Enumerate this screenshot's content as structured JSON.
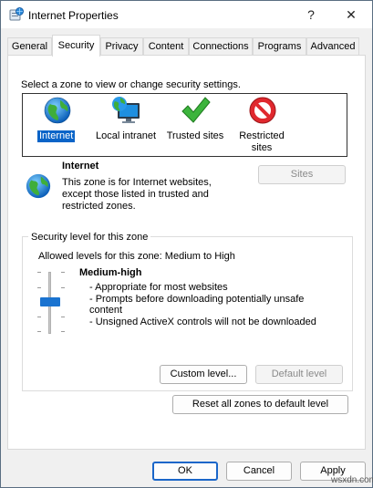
{
  "window": {
    "title": "Internet Properties",
    "help_glyph": "?",
    "close_glyph": "✕"
  },
  "tabs": [
    {
      "label": "General",
      "active": false
    },
    {
      "label": "Security",
      "active": true
    },
    {
      "label": "Privacy",
      "active": false
    },
    {
      "label": "Content",
      "active": false
    },
    {
      "label": "Connections",
      "active": false
    },
    {
      "label": "Programs",
      "active": false
    },
    {
      "label": "Advanced",
      "active": false
    }
  ],
  "security": {
    "prompt": "Select a zone to view or change security settings.",
    "zones": [
      {
        "label": "Internet",
        "icon": "globe-icon",
        "selected": true
      },
      {
        "label": "Local intranet",
        "icon": "monitor-globe-icon",
        "selected": false
      },
      {
        "label": "Trusted sites",
        "icon": "checkmark-icon",
        "selected": false
      },
      {
        "label": "Restricted\nsites",
        "icon": "no-entry-icon",
        "selected": false
      }
    ],
    "zone_info": {
      "name": "Internet",
      "description_lines": [
        "This zone is for Internet websites,",
        "except those listed in trusted and",
        "restricted zones."
      ]
    },
    "sites_button": "Sites",
    "level_group": {
      "title": "Security level for this zone",
      "allowed": "Allowed levels for this zone: Medium to High",
      "level_name": "Medium-high",
      "details": [
        "- Appropriate for most websites",
        "- Prompts before downloading potentially unsafe",
        "content",
        "- Unsigned ActiveX controls will not be downloaded"
      ],
      "custom_level_button": "Custom level...",
      "default_level_button": "Default level"
    },
    "reset_all_button": "Reset all zones to default level"
  },
  "footer": {
    "ok": "OK",
    "cancel": "Cancel",
    "apply": "Apply",
    "watermark": "wsxdn.com"
  },
  "colors": {
    "selection": "#0a64c8",
    "slider_thumb": "#1a73d0",
    "default_button_border": "#1a66c9"
  }
}
